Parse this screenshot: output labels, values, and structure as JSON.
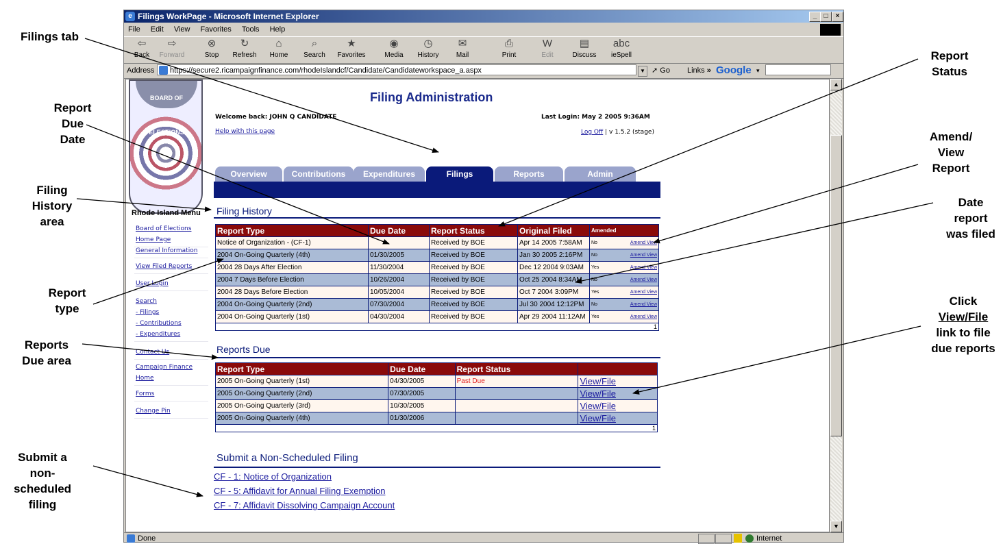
{
  "callouts": {
    "filings_tab": "Filings tab",
    "report_due_date": [
      "Report",
      "Due",
      "Date"
    ],
    "filing_history_area": [
      "Filing",
      "History",
      "area"
    ],
    "report_type": [
      "Report",
      "type"
    ],
    "reports_due_area": [
      "Reports",
      "Due area"
    ],
    "submit_non_scheduled": [
      "Submit a",
      "non-",
      "scheduled",
      "filing"
    ],
    "report_status": [
      "Report",
      "Status"
    ],
    "amend_view_report": [
      "Amend/",
      "View",
      "Report"
    ],
    "date_report_filed": [
      "Date",
      "report",
      "was filed"
    ],
    "click_view_file": [
      "Click",
      "View/File",
      "link to file",
      "due reports"
    ]
  },
  "window": {
    "title": "Filings WorkPage - Microsoft Internet Explorer",
    "controls": [
      "_",
      "□",
      "×"
    ],
    "menu": [
      "File",
      "Edit",
      "View",
      "Favorites",
      "Tools",
      "Help"
    ],
    "toolbar": [
      {
        "label": "Back",
        "icon": "⇦"
      },
      {
        "label": "Forward",
        "icon": "⇨"
      },
      {
        "label": "Stop",
        "icon": "⊗"
      },
      {
        "label": "Refresh",
        "icon": "↻"
      },
      {
        "label": "Home",
        "icon": "⌂"
      },
      {
        "label": "Search",
        "icon": "⌕"
      },
      {
        "label": "Favorites",
        "icon": "★"
      },
      {
        "label": "Media",
        "icon": "◉"
      },
      {
        "label": "History",
        "icon": "◷"
      },
      {
        "label": "Mail",
        "icon": "✉"
      },
      {
        "label": "Print",
        "icon": "⎙"
      },
      {
        "label": "Edit",
        "icon": "W"
      },
      {
        "label": "Discuss",
        "icon": "▤"
      },
      {
        "label": "ieSpell",
        "icon": "abc"
      }
    ],
    "address_label": "Address",
    "url": "https://secure2.ricampaignfinance.com/rhodeIslandcf/Candidate/Candidateworkspace_a.aspx",
    "go_label": "Go",
    "links_label": "Links",
    "google_label": "Google",
    "status_text": "Done",
    "zone_text": "Internet"
  },
  "page": {
    "heading": "Filing Administration",
    "welcome": "Welcome back: JOHN Q CANDIDATE",
    "last_login": "Last Login: May 2 2005 9:36AM",
    "help_link": "Help with this page",
    "logoff": "Log Off",
    "version": "| v 1.5.2 (stage)",
    "seal_text": "BOARD OF ELECTIONS",
    "menu_header": "Rhode Island Menu",
    "menu": [
      [
        "Board of Elections",
        "Home Page"
      ],
      [
        "General Information"
      ],
      [
        "View Filed Reports"
      ],
      [
        "User Login"
      ],
      [
        "Search",
        "- Filings",
        "- Contributions",
        "- Expenditures"
      ],
      [
        "Contact Us"
      ],
      [
        "Campaign Finance",
        "Home"
      ],
      [
        "Forms"
      ],
      [
        "Change Pin"
      ]
    ],
    "tabs": [
      "Overview",
      "Contributions",
      "Expenditures",
      "Filings",
      "Reports",
      "Admin"
    ],
    "active_tab": "Filings"
  },
  "history": {
    "title": "Filing History",
    "columns": [
      "Report Type",
      "Due Date",
      "Report Status",
      "Original Filed",
      "Amended"
    ],
    "rows": [
      {
        "type": "Notice of Organization - (CF-1)",
        "due": "",
        "status": "Received by BOE",
        "filed": "Apr 14 2005 7:58AM",
        "amended": "No"
      },
      {
        "type": "2004 On-Going Quarterly (4th)",
        "due": "01/30/2005",
        "status": "Received by BOE",
        "filed": "Jan 30 2005 2:16PM",
        "amended": "No"
      },
      {
        "type": "2004 28 Days After Election",
        "due": "11/30/2004",
        "status": "Received by BOE",
        "filed": "Dec 12 2004 9:03AM",
        "amended": "Yes"
      },
      {
        "type": "2004 7 Days Before Election",
        "due": "10/26/2004",
        "status": "Received by BOE",
        "filed": "Oct 25 2004 8:34AM",
        "amended": "No"
      },
      {
        "type": "2004 28 Days Before Election",
        "due": "10/05/2004",
        "status": "Received by BOE",
        "filed": "Oct 7 2004 3:09PM",
        "amended": "Yes"
      },
      {
        "type": "2004 On-Going Quarterly (2nd)",
        "due": "07/30/2004",
        "status": "Received by BOE",
        "filed": "Jul 30 2004 12:12PM",
        "amended": "No"
      },
      {
        "type": "2004 On-Going Quarterly (1st)",
        "due": "04/30/2004",
        "status": "Received by BOE",
        "filed": "Apr 29 2004 11:12AM",
        "amended": "Yes"
      }
    ],
    "amend_link": "Amend",
    "view_link": "View",
    "pager": "1"
  },
  "due": {
    "title": "Reports Due",
    "columns": [
      "Report Type",
      "Due Date",
      "Report Status",
      ""
    ],
    "rows": [
      {
        "type": "2005 On-Going Quarterly (1st)",
        "due": "04/30/2005",
        "status": "Past Due",
        "action": "View/File"
      },
      {
        "type": "2005 On-Going Quarterly (2nd)",
        "due": "07/30/2005",
        "status": "",
        "action": "View/File"
      },
      {
        "type": "2005 On-Going Quarterly (3rd)",
        "due": "10/30/2005",
        "status": "",
        "action": "View/File"
      },
      {
        "type": "2005 On-Going Quarterly (4th)",
        "due": "01/30/2006",
        "status": "",
        "action": "View/File"
      }
    ],
    "pager": "1"
  },
  "nonsched": {
    "title": "Submit a Non-Scheduled Filing",
    "links": [
      "CF - 1: Notice of Organization",
      "CF - 5: Affidavit for Annual Filing Exemption",
      "CF - 7: Affidavit Dissolving Campaign Account"
    ]
  }
}
